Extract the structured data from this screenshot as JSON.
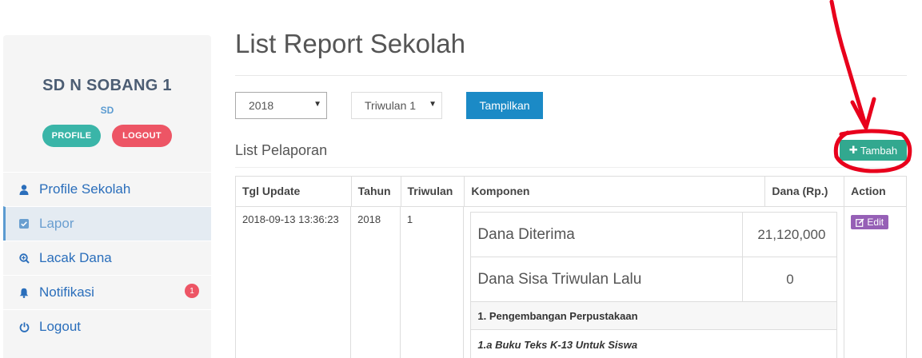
{
  "sidebar": {
    "school_name": "SD N SOBANG 1",
    "school_type": "SD",
    "profile_button": "PROFILE",
    "logout_button": "LOGOUT",
    "items": [
      {
        "label": "Profile Sekolah",
        "icon": "user-icon"
      },
      {
        "label": "Lapor",
        "icon": "check-square-icon",
        "active": true
      },
      {
        "label": "Lacak Dana",
        "icon": "search-plus-icon"
      },
      {
        "label": "Notifikasi",
        "icon": "bell-icon",
        "badge": "1"
      },
      {
        "label": "Logout",
        "icon": "power-icon"
      }
    ]
  },
  "header": {
    "title": "List Report Sekolah"
  },
  "filters": {
    "year": "2018",
    "triwulan": "Triwulan 1",
    "show_button": "Tampilkan"
  },
  "section": {
    "title": "List Pelaporan",
    "add_button": "Tambah"
  },
  "table": {
    "headers": [
      "Tgl Update",
      "Tahun",
      "Triwulan",
      "Komponen",
      "Dana (Rp.)",
      "Action"
    ],
    "row": {
      "tgl_update": "2018-09-13 13:36:23",
      "tahun": "2018",
      "triwulan": "1",
      "edit_button": "Edit",
      "components": {
        "dana_diterima_label": "Dana Diterima",
        "dana_diterima_value": "21,120,000",
        "dana_sisa_label": "Dana Sisa Triwulan Lalu",
        "dana_sisa_value": "0",
        "category": "1. Pengembangan Perpustakaan",
        "subcategory": "1.a Buku Teks K-13 Untuk Siswa"
      }
    }
  },
  "colors": {
    "primary_button": "#1b8ac6",
    "add_button": "#32a88f",
    "edit_button": "#9660b6",
    "profile_pill": "#3ab5a8",
    "logout_pill": "#ed5565",
    "annotation_red": "#e8001c"
  }
}
